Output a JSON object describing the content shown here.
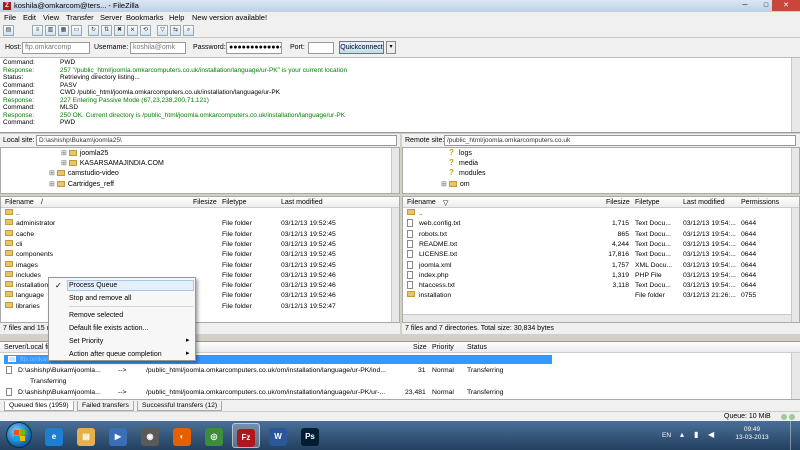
{
  "window": {
    "title": "koshila@omkarcom@ters... - FileZilla",
    "minimize": "─",
    "maximize": "□",
    "close": "✕"
  },
  "menu": [
    "File",
    "Edit",
    "View",
    "Transfer",
    "Server",
    "Bookmarks",
    "Help",
    "New version available!"
  ],
  "quickconnect": {
    "host_label": "Host:",
    "host_value": "ftp.omkarcomp",
    "username_label": "Username:",
    "username_value": "koshila@omk",
    "password_label": "Password:",
    "password_value": "●●●●●●●●●●●●●",
    "port_label": "Port:",
    "port_value": "",
    "button": "Quickconnect",
    "dropdown": "▾"
  },
  "log": [
    {
      "kind": "Command:",
      "msg": "PWD",
      "color": "#000000"
    },
    {
      "kind": "Response:",
      "msg": "257 \"/public_html/joomla.omkarcomputers.co.uk/installation/language/ur-PK\" is your current location",
      "color": "#008000"
    },
    {
      "kind": "Status:",
      "msg": "Retrieving directory listing...",
      "color": "#000000"
    },
    {
      "kind": "Command:",
      "msg": "PASV",
      "color": "#000000"
    },
    {
      "kind": "Command:",
      "msg": "CWD /public_html/joomla.omkarcomputers.co.uk/installation/language/ur-PK",
      "color": "#000000"
    },
    {
      "kind": "Response:",
      "msg": "227 Entering Passive Mode (67,23,238,200,71,121)",
      "color": "#008000"
    },
    {
      "kind": "Command:",
      "msg": "MLSD",
      "color": "#000000"
    },
    {
      "kind": "Response:",
      "msg": "250 OK. Current directory is /public_html/joomla.omkarcomputers.co.uk/installation/language/ur-PK",
      "color": "#008000"
    },
    {
      "kind": "Command:",
      "msg": "PWD",
      "color": "#000000"
    }
  ],
  "local": {
    "site_label": "Local site:",
    "site_path": "D:\\ashishp\\Bukam\\joomla25\\",
    "tree": [
      {
        "label": "joomla25",
        "indent": 2
      },
      {
        "label": "KASARSAMAJINDIA.COM",
        "indent": 2
      },
      {
        "label": "camstudio-video",
        "indent": 1
      },
      {
        "label": "Cartridges_reff",
        "indent": 1
      }
    ],
    "columns": [
      "Filename",
      "/",
      "Filesize",
      "Filetype",
      "Last modified"
    ],
    "rows": [
      {
        "name": "..",
        "size": "",
        "type": "",
        "modified": ""
      },
      {
        "name": "administrator",
        "size": "",
        "type": "File folder",
        "modified": "03/12/13 19:52:45"
      },
      {
        "name": "cache",
        "size": "",
        "type": "File folder",
        "modified": "03/12/13 19:52:45"
      },
      {
        "name": "cli",
        "size": "",
        "type": "File folder",
        "modified": "03/12/13 19:52:45"
      },
      {
        "name": "components",
        "size": "",
        "type": "File folder",
        "modified": "03/12/13 19:52:45"
      },
      {
        "name": "images",
        "size": "",
        "type": "File folder",
        "modified": "03/12/13 19:52:45"
      },
      {
        "name": "includes",
        "size": "",
        "type": "File folder",
        "modified": "03/12/13 19:52:46"
      },
      {
        "name": "installation",
        "size": "",
        "type": "File folder",
        "modified": "03/12/13 19:52:46"
      },
      {
        "name": "language",
        "size": "",
        "type": "File folder",
        "modified": "03/12/13 19:52:46"
      },
      {
        "name": "libraries",
        "size": "",
        "type": "File folder",
        "modified": "03/12/13 19:52:47"
      }
    ],
    "status": "7 files and 15 directories. Total size: 30,834 bytes"
  },
  "remote": {
    "site_label": "Remote site:",
    "site_path": "/public_html/joomla.omkarcomputers.co.uk",
    "tree": [
      {
        "label": "logs",
        "icon": "question"
      },
      {
        "label": "media",
        "icon": "question"
      },
      {
        "label": "modules",
        "icon": "question"
      },
      {
        "label": "om",
        "icon": "folder"
      }
    ],
    "columns": [
      "Filename",
      "▽",
      "Filesize",
      "Filetype",
      "Last modified",
      "Permissions"
    ],
    "rows": [
      {
        "name": "..",
        "size": "",
        "type": "",
        "modified": "",
        "perm": "",
        "icon": "folder"
      },
      {
        "name": "web.config.txt",
        "size": "1,715",
        "type": "Text Docu...",
        "modified": "03/12/13 19:54:...",
        "perm": "0644",
        "icon": "file"
      },
      {
        "name": "robots.txt",
        "size": "865",
        "type": "Text Docu...",
        "modified": "03/12/13 19:54:...",
        "perm": "0644",
        "icon": "file"
      },
      {
        "name": "README.txt",
        "size": "4,244",
        "type": "Text Docu...",
        "modified": "03/12/13 19:54:...",
        "perm": "0644",
        "icon": "file"
      },
      {
        "name": "LICENSE.txt",
        "size": "17,816",
        "type": "Text Docu...",
        "modified": "03/12/13 19:54:...",
        "perm": "0644",
        "icon": "file"
      },
      {
        "name": "joomla.xml",
        "size": "1,757",
        "type": "XML Docu...",
        "modified": "03/12/13 19:54:...",
        "perm": "0644",
        "icon": "file"
      },
      {
        "name": "index.php",
        "size": "1,319",
        "type": "PHP File",
        "modified": "03/12/13 19:54:...",
        "perm": "0644",
        "icon": "file"
      },
      {
        "name": "htaccess.txt",
        "size": "3,118",
        "type": "Text Docu...",
        "modified": "03/12/13 19:54:...",
        "perm": "0644",
        "icon": "file"
      },
      {
        "name": "installation",
        "size": "",
        "type": "File folder",
        "modified": "03/12/13 21:26:...",
        "perm": "0755",
        "icon": "folder"
      }
    ],
    "status": "7 files and 7 directories. Total size: 30,834 bytes"
  },
  "context_menu": {
    "check": "✓",
    "submenu_arrow": "▸",
    "items": [
      "Process Queue",
      "Stop and remove all",
      "Remove selected",
      "Default file exists action...",
      "Set Priority",
      "Action after queue completion"
    ]
  },
  "queue": {
    "columns": [
      "Server/Local fi",
      "Size",
      "Priority",
      "Status"
    ],
    "selected_row": "ftp.omkarcomputers.co.uk",
    "rows": [
      {
        "local": "D:\\ashishp\\Bukam\\joomla...",
        "dir": "-->",
        "remote": "/public_html/joomla.omkarcomputers.co.uk/om/installation/language/ur-PK/ind...",
        "size": "31",
        "priority": "Normal",
        "status": "Transferring"
      },
      {
        "local": "Transferring",
        "dir": "",
        "remote": "",
        "size": "",
        "priority": "",
        "status": ""
      },
      {
        "local": "D:\\ashishp\\Bukam\\joomla...",
        "dir": "-->",
        "remote": "/public_html/joomla.omkarcomputers.co.uk/om/installation/language/ur-PK/ur-...",
        "size": "23,481",
        "priority": "Normal",
        "status": "Transferring"
      }
    ]
  },
  "tabs": [
    "Queued files (1959)",
    "Failed transfers",
    "Successful transfers (12)"
  ],
  "statusbar": {
    "queue": "Queue: 10 MiB"
  },
  "taskbar": {
    "apps": [
      {
        "name": "ie",
        "glyph": "e"
      },
      {
        "name": "explorer",
        "glyph": "▤"
      },
      {
        "name": "media",
        "glyph": "▶"
      },
      {
        "name": "camstudio",
        "glyph": "◉"
      },
      {
        "name": "firefox",
        "glyph": "◐"
      },
      {
        "name": "chrome",
        "glyph": "◎"
      },
      {
        "name": "filezilla",
        "glyph": "Fz"
      },
      {
        "name": "word",
        "glyph": "W"
      },
      {
        "name": "photoshop",
        "glyph": "Ps"
      }
    ],
    "language": "EN",
    "time": "09:49",
    "date": "13-03-2013"
  },
  "colors": {
    "response": "#008000",
    "selection": "#3399ff",
    "accent": "#b0161b"
  }
}
